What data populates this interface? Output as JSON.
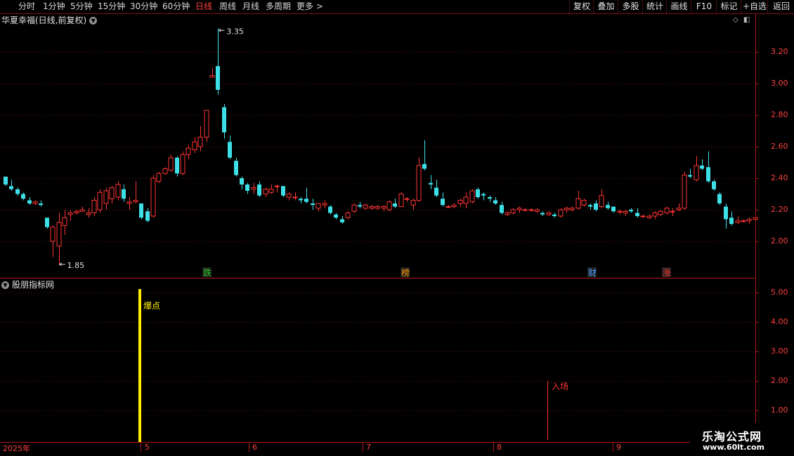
{
  "toolbar": {
    "periods": [
      "分时",
      "1分钟",
      "5分钟",
      "15分钟",
      "30分钟",
      "60分钟",
      "日线",
      "周线",
      "月线",
      "多周期",
      "更多"
    ],
    "active_period": "日线",
    "right_buttons": [
      "复权",
      "叠加",
      "多股",
      "统计",
      "画线",
      "F10",
      "标记",
      "+自选",
      "返回"
    ]
  },
  "main": {
    "title": "华夏幸福(日线,前复权)",
    "high_label": "3.35",
    "low_label": "1.85",
    "markers": [
      {
        "text": "跌",
        "color": "#22cc22"
      },
      {
        "text": "榜",
        "color": "#ff9900"
      },
      {
        "text": "财",
        "color": "#4aa0ff"
      },
      {
        "text": "涨",
        "color": "#ff3333"
      }
    ]
  },
  "indicator": {
    "title": "股朋指标网",
    "signal_1": "爆点",
    "signal_2": "入场"
  },
  "axis": {
    "year": "2025年",
    "months": [
      "5",
      "6",
      "7",
      "8",
      "9"
    ],
    "price_ticks": [
      "3.20",
      "3.00",
      "2.80",
      "2.60",
      "2.40",
      "2.20",
      "2.00"
    ],
    "indicator_ticks": [
      "5.00",
      "4.00",
      "3.00",
      "2.00",
      "1.00"
    ]
  },
  "logo": {
    "line1": "乐淘公式网",
    "line2": "www.60lt.com"
  },
  "chart_data": {
    "type": "candlestick",
    "title": "华夏幸福(日线,前复权)",
    "price_range": [
      1.8,
      3.4
    ],
    "ohlc": [
      [
        2.41,
        2.41,
        2.35,
        2.36
      ],
      [
        2.35,
        2.39,
        2.32,
        2.33
      ],
      [
        2.33,
        2.34,
        2.29,
        2.3
      ],
      [
        2.3,
        2.31,
        2.26,
        2.27
      ],
      [
        2.26,
        2.28,
        2.23,
        2.24
      ],
      [
        2.24,
        2.26,
        2.23,
        2.25
      ],
      [
        2.24,
        2.26,
        2.22,
        2.23
      ],
      [
        2.15,
        2.15,
        2.08,
        2.09
      ],
      [
        2.0,
        2.1,
        1.9,
        2.09
      ],
      [
        1.97,
        2.18,
        1.85,
        2.12
      ],
      [
        2.1,
        2.2,
        2.04,
        2.15
      ],
      [
        2.17,
        2.2,
        2.13,
        2.18
      ],
      [
        2.18,
        2.2,
        2.17,
        2.19
      ],
      [
        2.19,
        2.22,
        2.19,
        2.2
      ],
      [
        2.17,
        2.21,
        2.15,
        2.18
      ],
      [
        2.18,
        2.28,
        2.16,
        2.26
      ],
      [
        2.2,
        2.33,
        2.18,
        2.31
      ],
      [
        2.24,
        2.34,
        2.2,
        2.32
      ],
      [
        2.27,
        2.35,
        2.24,
        2.34
      ],
      [
        2.28,
        2.38,
        2.26,
        2.36
      ],
      [
        2.33,
        2.36,
        2.25,
        2.27
      ],
      [
        2.24,
        2.28,
        2.2,
        2.25
      ],
      [
        2.25,
        2.38,
        2.24,
        2.26
      ],
      [
        2.24,
        2.24,
        2.14,
        2.15
      ],
      [
        2.19,
        2.21,
        2.12,
        2.13
      ],
      [
        2.16,
        2.42,
        2.15,
        2.4
      ],
      [
        2.38,
        2.44,
        2.37,
        2.43
      ],
      [
        2.43,
        2.47,
        2.42,
        2.46
      ],
      [
        2.45,
        2.55,
        2.44,
        2.53
      ],
      [
        2.53,
        2.54,
        2.41,
        2.43
      ],
      [
        2.43,
        2.57,
        2.42,
        2.55
      ],
      [
        2.55,
        2.61,
        2.52,
        2.59
      ],
      [
        2.58,
        2.66,
        2.56,
        2.63
      ],
      [
        2.6,
        2.73,
        2.57,
        2.66
      ],
      [
        2.66,
        2.83,
        2.63,
        2.83
      ],
      [
        3.04,
        3.1,
        3.04,
        3.05
      ],
      [
        3.11,
        3.35,
        2.93,
        2.96
      ],
      [
        2.85,
        2.87,
        2.65,
        2.69
      ],
      [
        2.63,
        2.67,
        2.52,
        2.53
      ],
      [
        2.51,
        2.53,
        2.41,
        2.42
      ],
      [
        2.4,
        2.41,
        2.33,
        2.36
      ],
      [
        2.36,
        2.37,
        2.3,
        2.32
      ],
      [
        2.33,
        2.37,
        2.3,
        2.34
      ],
      [
        2.36,
        2.38,
        2.28,
        2.29
      ],
      [
        2.3,
        2.34,
        2.28,
        2.33
      ],
      [
        2.31,
        2.36,
        2.3,
        2.33
      ],
      [
        2.35,
        2.36,
        2.31,
        2.35
      ],
      [
        2.35,
        2.35,
        2.28,
        2.29
      ],
      [
        2.28,
        2.31,
        2.26,
        2.3
      ],
      [
        2.28,
        2.31,
        2.26,
        2.28
      ],
      [
        2.27,
        2.28,
        2.24,
        2.26
      ],
      [
        2.27,
        2.34,
        2.24,
        2.25
      ],
      [
        2.24,
        2.27,
        2.2,
        2.23
      ],
      [
        2.21,
        2.24,
        2.19,
        2.24
      ],
      [
        2.23,
        2.26,
        2.21,
        2.24
      ],
      [
        2.22,
        2.23,
        2.17,
        2.18
      ],
      [
        2.17,
        2.18,
        2.14,
        2.15
      ],
      [
        2.14,
        2.16,
        2.11,
        2.12
      ],
      [
        2.15,
        2.19,
        2.14,
        2.18
      ],
      [
        2.19,
        2.24,
        2.18,
        2.23
      ],
      [
        2.23,
        2.25,
        2.21,
        2.22
      ],
      [
        2.21,
        2.24,
        2.2,
        2.23
      ],
      [
        2.21,
        2.23,
        2.2,
        2.22
      ],
      [
        2.21,
        2.23,
        2.2,
        2.22
      ],
      [
        2.21,
        2.23,
        2.19,
        2.22
      ],
      [
        2.2,
        2.26,
        2.19,
        2.25
      ],
      [
        2.24,
        2.27,
        2.21,
        2.22
      ],
      [
        2.22,
        2.31,
        2.22,
        2.3
      ],
      [
        2.27,
        2.28,
        2.25,
        2.27
      ],
      [
        2.23,
        2.27,
        2.2,
        2.26
      ],
      [
        2.26,
        2.53,
        2.25,
        2.48
      ],
      [
        2.49,
        2.64,
        2.45,
        2.46
      ],
      [
        2.37,
        2.42,
        2.33,
        2.36
      ],
      [
        2.34,
        2.39,
        2.28,
        2.29
      ],
      [
        2.27,
        2.31,
        2.22,
        2.23
      ],
      [
        2.22,
        2.23,
        2.21,
        2.22
      ],
      [
        2.22,
        2.24,
        2.21,
        2.23
      ],
      [
        2.24,
        2.27,
        2.22,
        2.26
      ],
      [
        2.24,
        2.31,
        2.21,
        2.28
      ],
      [
        2.25,
        2.33,
        2.24,
        2.32
      ],
      [
        2.33,
        2.34,
        2.27,
        2.28
      ],
      [
        2.3,
        2.31,
        2.26,
        2.29
      ],
      [
        2.28,
        2.29,
        2.25,
        2.27
      ],
      [
        2.26,
        2.28,
        2.23,
        2.24
      ],
      [
        2.23,
        2.25,
        2.17,
        2.18
      ],
      [
        2.17,
        2.19,
        2.16,
        2.18
      ],
      [
        2.18,
        2.21,
        2.17,
        2.2
      ],
      [
        2.2,
        2.22,
        2.18,
        2.21
      ],
      [
        2.2,
        2.21,
        2.19,
        2.2
      ],
      [
        2.2,
        2.21,
        2.19,
        2.2
      ],
      [
        2.19,
        2.21,
        2.18,
        2.2
      ],
      [
        2.18,
        2.19,
        2.16,
        2.17
      ],
      [
        2.17,
        2.19,
        2.16,
        2.18
      ],
      [
        2.17,
        2.18,
        2.15,
        2.16
      ],
      [
        2.16,
        2.21,
        2.15,
        2.2
      ],
      [
        2.2,
        2.22,
        2.18,
        2.21
      ],
      [
        2.2,
        2.22,
        2.19,
        2.21
      ],
      [
        2.21,
        2.32,
        2.2,
        2.27
      ],
      [
        2.23,
        2.27,
        2.22,
        2.26
      ],
      [
        2.23,
        2.24,
        2.2,
        2.22
      ],
      [
        2.24,
        2.26,
        2.19,
        2.2
      ],
      [
        2.22,
        2.33,
        2.21,
        2.29
      ],
      [
        2.23,
        2.25,
        2.2,
        2.21
      ],
      [
        2.22,
        2.22,
        2.18,
        2.19
      ],
      [
        2.19,
        2.2,
        2.17,
        2.19
      ],
      [
        2.18,
        2.2,
        2.16,
        2.19
      ],
      [
        2.2,
        2.21,
        2.18,
        2.19
      ],
      [
        2.18,
        2.21,
        2.15,
        2.16
      ],
      [
        2.16,
        2.17,
        2.15,
        2.16
      ],
      [
        2.15,
        2.17,
        2.14,
        2.16
      ],
      [
        2.16,
        2.19,
        2.14,
        2.18
      ],
      [
        2.17,
        2.2,
        2.16,
        2.19
      ],
      [
        2.18,
        2.22,
        2.17,
        2.21
      ],
      [
        2.19,
        2.21,
        2.16,
        2.19
      ],
      [
        2.2,
        2.24,
        2.19,
        2.21
      ],
      [
        2.21,
        2.44,
        2.2,
        2.42
      ],
      [
        2.42,
        2.46,
        2.4,
        2.41
      ],
      [
        2.39,
        2.54,
        2.38,
        2.48
      ],
      [
        2.48,
        2.52,
        2.45,
        2.46
      ],
      [
        2.47,
        2.57,
        2.37,
        2.38
      ],
      [
        2.38,
        2.39,
        2.32,
        2.33
      ],
      [
        2.3,
        2.31,
        2.23,
        2.24
      ],
      [
        2.22,
        2.24,
        2.08,
        2.14
      ],
      [
        2.15,
        2.19,
        2.1,
        2.11
      ],
      [
        2.12,
        2.16,
        2.11,
        2.13
      ],
      [
        2.13,
        2.14,
        2.12,
        2.13
      ],
      [
        2.13,
        2.15,
        2.11,
        2.14
      ],
      [
        2.14,
        2.15,
        2.13,
        2.15
      ]
    ],
    "indicator": {
      "ylim": [
        0.5,
        5.5
      ],
      "signals": [
        {
          "label": "爆点",
          "bar_index": 35,
          "value": 5.0,
          "color": "#ffee00"
        },
        {
          "label": "入场",
          "bar_index": 97,
          "value": 2.0,
          "color": "#ff3333"
        }
      ]
    },
    "up_color": "#ff3333",
    "down_color": "#3ee0e8",
    "axis_color": "#ff2020",
    "grid": "dotted"
  }
}
